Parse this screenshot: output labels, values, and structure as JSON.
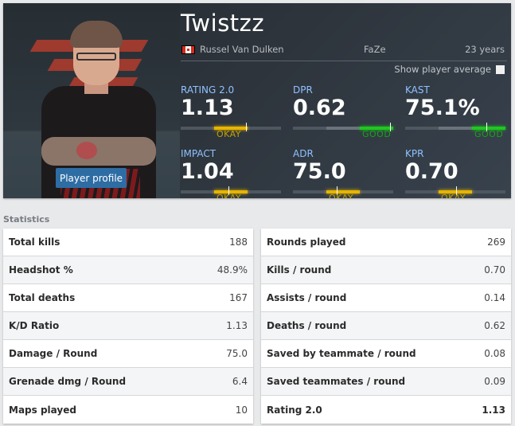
{
  "player": {
    "nickname": "Twistzz",
    "real_name": "Russel Van Dulken",
    "country_flag": "canada-flag",
    "team": "FaZe",
    "age": "23 years",
    "profile_button": "Player profile",
    "show_average_label": "Show player average",
    "show_average_checked": false
  },
  "summary": [
    {
      "label": "RATING 2.0",
      "value": "1.13",
      "rating": "OKAY",
      "level": "okay",
      "fill_from": 0.333,
      "fill_to": 0.667,
      "marker": 0.65
    },
    {
      "label": "DPR",
      "value": "0.62",
      "rating": "GOOD",
      "level": "good",
      "fill_from": 0.667,
      "fill_to": 1.0,
      "marker": 0.97
    },
    {
      "label": "KAST",
      "value": "75.1%",
      "rating": "GOOD",
      "level": "good",
      "fill_from": 0.667,
      "fill_to": 1.0,
      "marker": 0.81
    },
    {
      "label": "IMPACT",
      "value": "1.04",
      "rating": "OKAY",
      "level": "okay",
      "fill_from": 0.333,
      "fill_to": 0.667,
      "marker": 0.48
    },
    {
      "label": "ADR",
      "value": "75.0",
      "rating": "OKAY",
      "level": "okay",
      "fill_from": 0.333,
      "fill_to": 0.667,
      "marker": 0.44
    },
    {
      "label": "KPR",
      "value": "0.70",
      "rating": "OKAY",
      "level": "okay",
      "fill_from": 0.333,
      "fill_to": 0.667,
      "marker": 0.51
    }
  ],
  "statistics": {
    "title": "Statistics",
    "left": [
      {
        "label": "Total kills",
        "value": "188"
      },
      {
        "label": "Headshot %",
        "value": "48.9%"
      },
      {
        "label": "Total deaths",
        "value": "167"
      },
      {
        "label": "K/D Ratio",
        "value": "1.13"
      },
      {
        "label": "Damage / Round",
        "value": "75.0"
      },
      {
        "label": "Grenade dmg / Round",
        "value": "6.4"
      },
      {
        "label": "Maps played",
        "value": "10"
      }
    ],
    "right": [
      {
        "label": "Rounds played",
        "value": "269"
      },
      {
        "label": "Kills / round",
        "value": "0.70"
      },
      {
        "label": "Assists / round",
        "value": "0.14"
      },
      {
        "label": "Deaths / round",
        "value": "0.62"
      },
      {
        "label": "Saved by teammate / round",
        "value": "0.08"
      },
      {
        "label": "Saved teammates / round",
        "value": "0.09"
      },
      {
        "label": "Rating 2.0",
        "value": "1.13",
        "bold": true
      }
    ]
  },
  "colors": {
    "okay": "#e6b500",
    "good": "#1fc71f",
    "label_blue": "#8fc2ff",
    "button_blue": "#2e6da4"
  }
}
